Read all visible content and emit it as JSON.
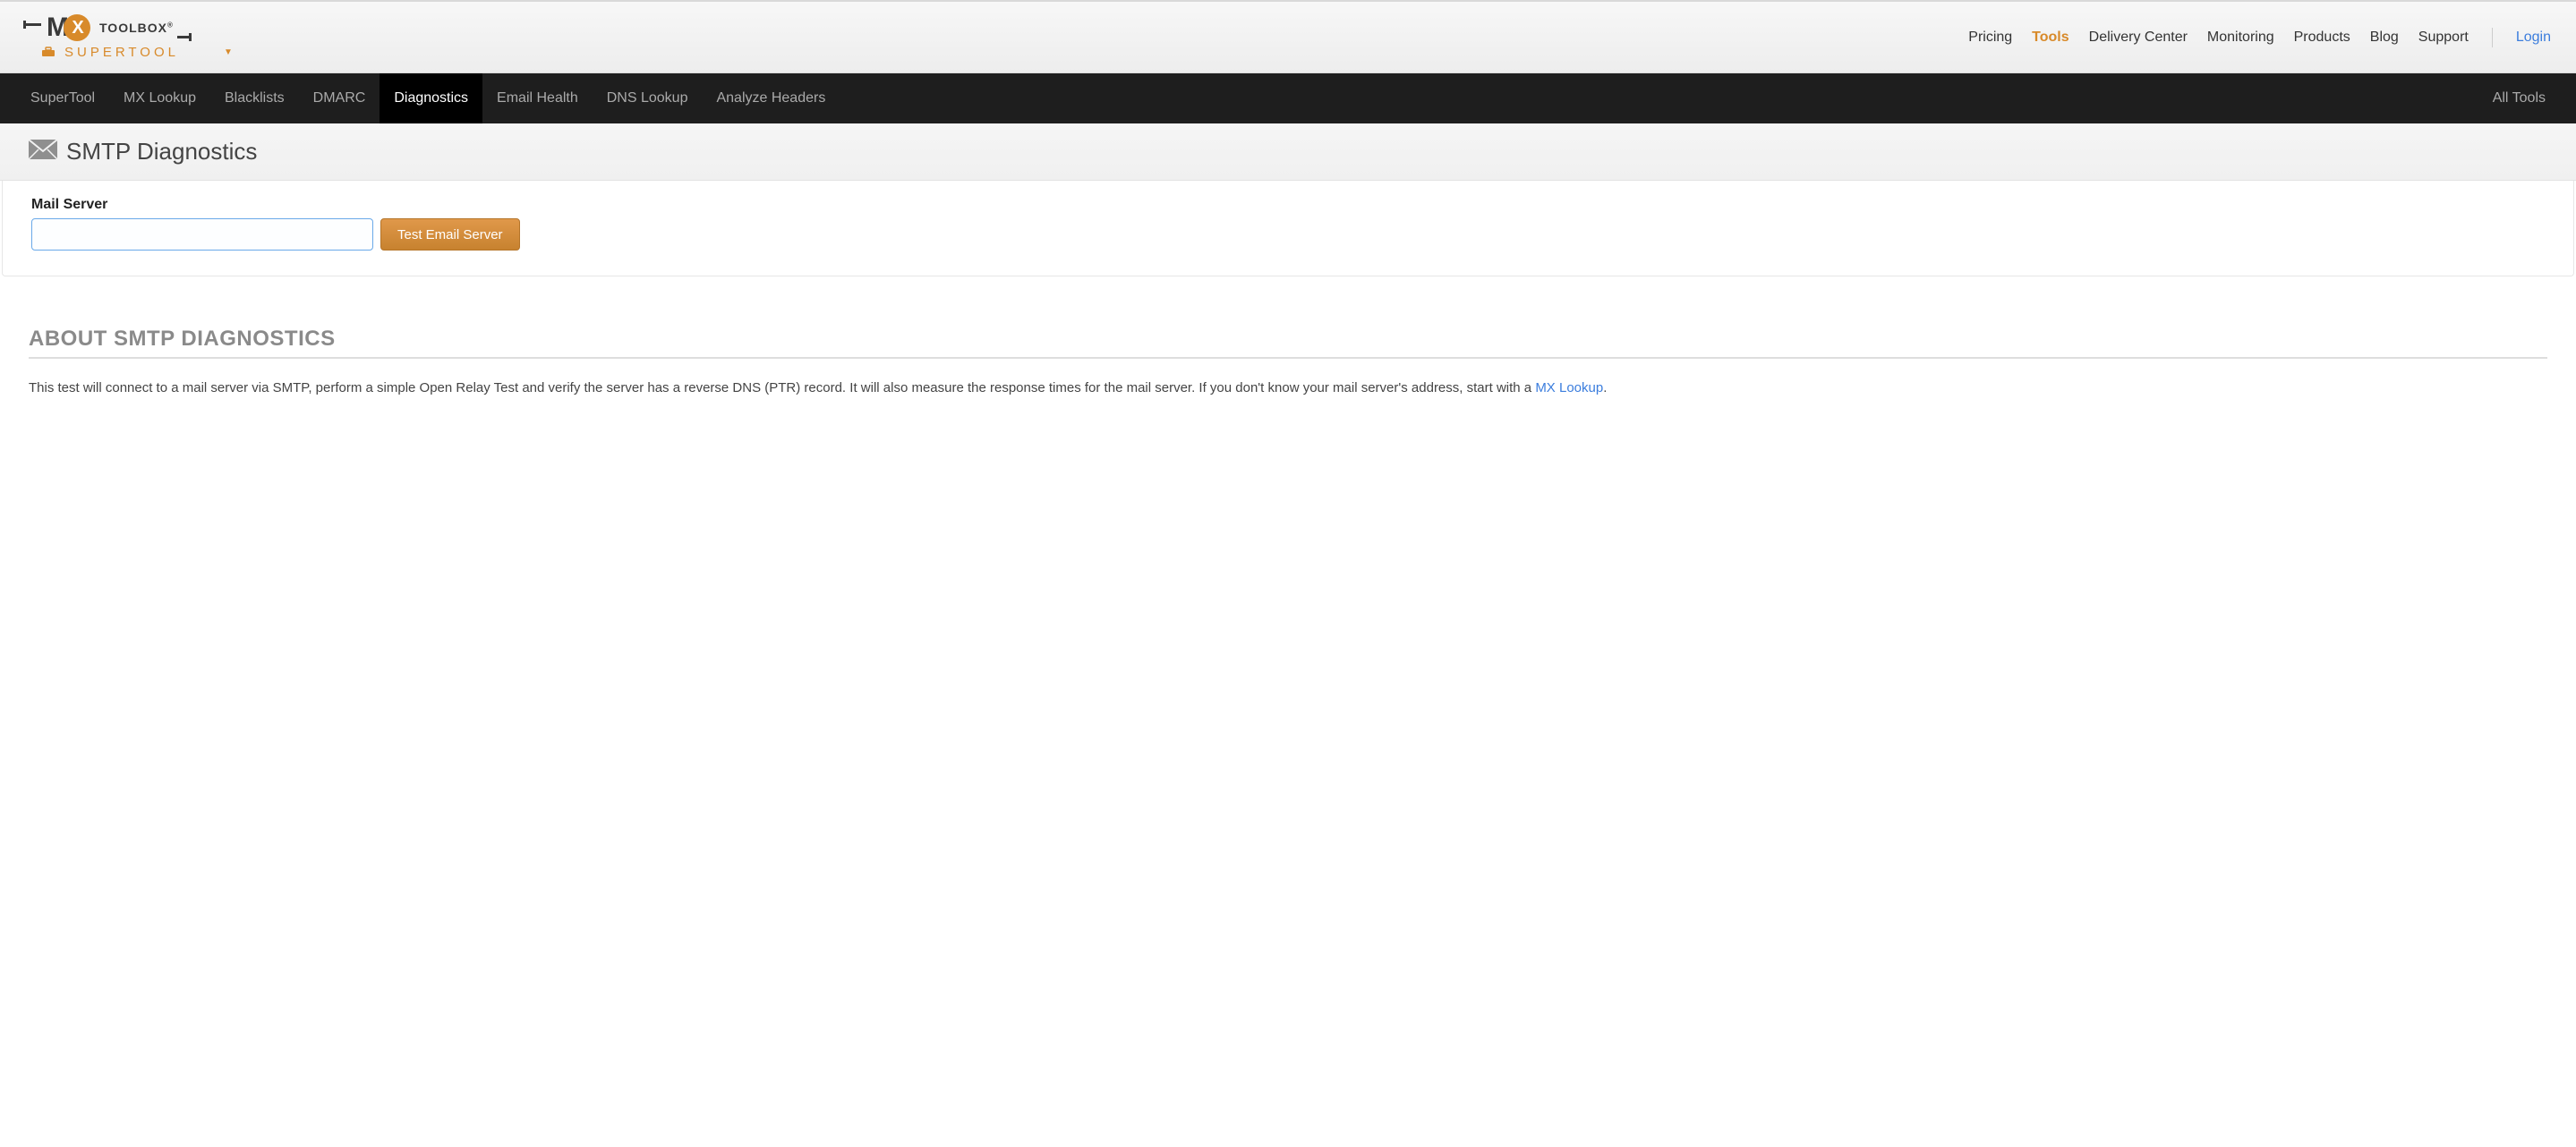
{
  "brand": {
    "m": "M",
    "x": "X",
    "toolbox": "TOOLBOX",
    "reg": "®",
    "supertool": "SUPERTOOL"
  },
  "topnav": {
    "pricing": "Pricing",
    "tools": "Tools",
    "delivery": "Delivery Center",
    "monitoring": "Monitoring",
    "products": "Products",
    "blog": "Blog",
    "support": "Support",
    "login": "Login"
  },
  "subnav": {
    "supertool": "SuperTool",
    "mxlookup": "MX Lookup",
    "blacklists": "Blacklists",
    "dmarc": "DMARC",
    "diagnostics": "Diagnostics",
    "emailhealth": "Email Health",
    "dnslookup": "DNS Lookup",
    "analyze": "Analyze Headers",
    "alltools": "All Tools"
  },
  "page": {
    "title": "SMTP Diagnostics",
    "field_label": "Mail Server",
    "input_value": "",
    "button": "Test Email Server"
  },
  "about": {
    "title": "ABOUT SMTP DIAGNOSTICS",
    "body": "This test will connect to a mail server via SMTP, perform a simple Open Relay Test and verify the server has a reverse DNS (PTR) record.  It will also measure the response times for the mail server.  If you don't know your mail server's address, start with a ",
    "link": "MX Lookup",
    "period": "."
  }
}
